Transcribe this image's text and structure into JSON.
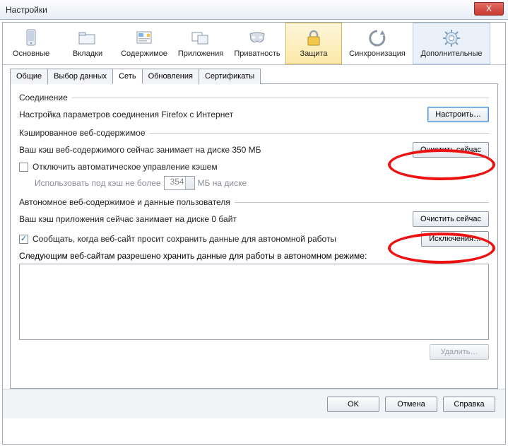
{
  "window": {
    "title": "Настройки",
    "close": "X"
  },
  "toolbar": {
    "items": [
      {
        "label": "Основные"
      },
      {
        "label": "Вкладки"
      },
      {
        "label": "Содержимое"
      },
      {
        "label": "Приложения"
      },
      {
        "label": "Приватность"
      },
      {
        "label": "Защита"
      },
      {
        "label": "Синхронизация"
      },
      {
        "label": "Дополнительные"
      }
    ]
  },
  "tabs": {
    "items": [
      "Общие",
      "Выбор данных",
      "Сеть",
      "Обновления",
      "Сертификаты"
    ],
    "active": "Сеть"
  },
  "connection": {
    "legend": "Соединение",
    "desc": "Настройка параметров соединения Firefox с Интернет",
    "configure_btn": "Настроить…"
  },
  "cached": {
    "legend": "Кэшированное веб-содержимое",
    "usage": "Ваш кэш веб-содержимого сейчас занимает на диске 350 МБ",
    "clear_btn": "Очистить сейчас",
    "disable_auto": "Отключить автоматическое управление кэшем",
    "limit_prefix": "Использовать под кэш не более",
    "limit_value": "354",
    "limit_suffix": "МБ на диске"
  },
  "offline": {
    "legend": "Автономное веб-содержимое и данные пользователя",
    "usage": "Ваш кэш приложения сейчас занимает на диске 0 байт",
    "clear_btn": "Очистить сейчас",
    "notify": "Сообщать, когда веб-сайт просит сохранить данные для автономной работы",
    "exceptions_btn": "Исключения…",
    "allowed_label": "Следующим веб-сайтам разрешено хранить данные для работы в автономном режиме:",
    "delete_btn": "Удалить…"
  },
  "footer": {
    "ok": "OK",
    "cancel": "Отмена",
    "help": "Справка"
  }
}
